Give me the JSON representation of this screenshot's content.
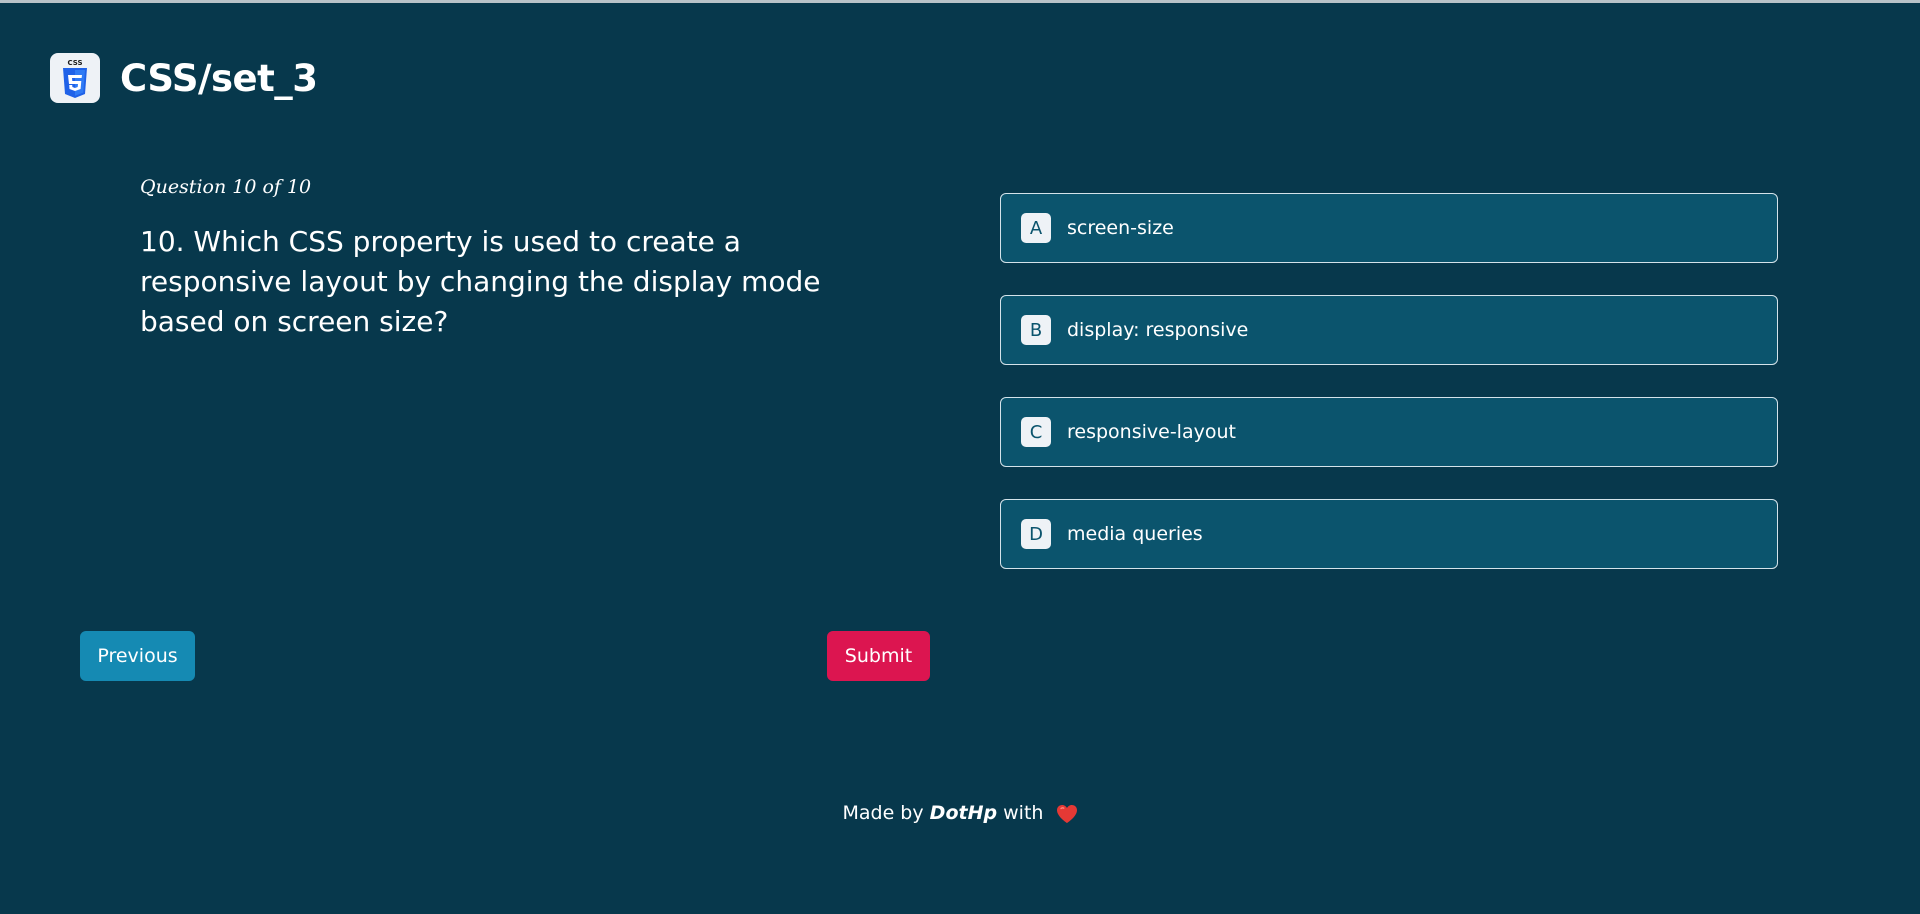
{
  "app": {
    "title": "CSS/set_3",
    "logo_text": "CSS"
  },
  "quiz": {
    "counter": "Question 10 of 10",
    "question": "10.  Which CSS property is used to create a responsive layout by changing the display mode based on screen size?",
    "options": [
      {
        "letter": "A",
        "label": "screen-size"
      },
      {
        "letter": "B",
        "label": "display: responsive"
      },
      {
        "letter": "C",
        "label": "responsive-layout"
      },
      {
        "letter": "D",
        "label": "media queries"
      }
    ]
  },
  "nav": {
    "previous_label": "Previous",
    "submit_label": "Submit"
  },
  "footer": {
    "prefix": "Made by",
    "author": "DotHp",
    "suffix": "with",
    "icon": "heart-icon"
  },
  "colors": {
    "background": "#07384c",
    "option_bg": "#0b546d",
    "previous_button": "#158ab3",
    "submit_button": "#dc1550",
    "css_logo_shield": "#1f62e8",
    "heart": "#e53935"
  }
}
